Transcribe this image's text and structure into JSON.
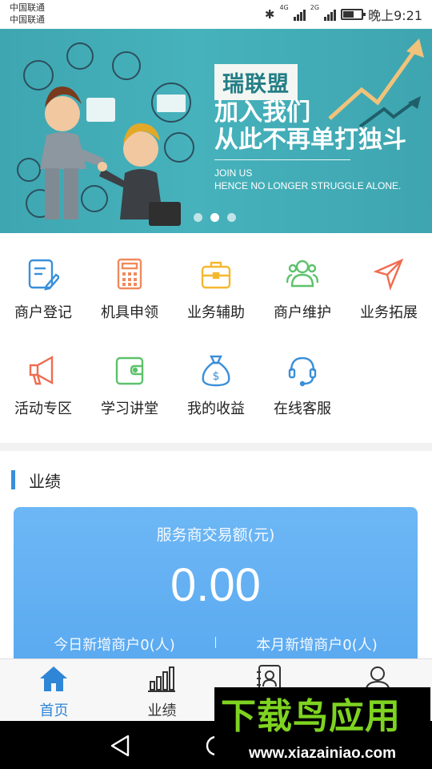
{
  "status_bar": {
    "carrier_1": "中国联通",
    "carrier_2": "中国联通",
    "network_1": "4G",
    "network_2": "2G",
    "time": "晚上9:21",
    "battery_level": 0.6
  },
  "banner": {
    "brand": "瑞联盟",
    "headline_1": "加入我们",
    "headline_2": "从此不再单打独斗",
    "sub_1": "JOIN US",
    "sub_2": "HENCE NO LONGER STRUGGLE ALONE.",
    "slide_count": 3,
    "active_slide": 2
  },
  "menu": {
    "items": [
      {
        "label": "商户登记",
        "icon": "edit-document-icon",
        "color": "#3a8fd9"
      },
      {
        "label": "机具申领",
        "icon": "calculator-icon",
        "color": "#f08a5d"
      },
      {
        "label": "业务辅助",
        "icon": "briefcase-icon",
        "color": "#f5b82e"
      },
      {
        "label": "商户维护",
        "icon": "users-icon",
        "color": "#5cc26b"
      },
      {
        "label": "业务拓展",
        "icon": "send-icon",
        "color": "#f06c50"
      },
      {
        "label": "活动专区",
        "icon": "megaphone-icon",
        "color": "#f06c50"
      },
      {
        "label": "学习讲堂",
        "icon": "wallet-icon",
        "color": "#5cc26b"
      },
      {
        "label": "我的收益",
        "icon": "money-bag-icon",
        "color": "#3a8fd9"
      },
      {
        "label": "在线客服",
        "icon": "headset-icon",
        "color": "#3a8fd9"
      }
    ]
  },
  "performance": {
    "title": "业绩",
    "card_label": "服务商交易额(元)",
    "amount": "0.00",
    "today_new": "今日新增商户0(人)",
    "month_new": "本月新增商户0(人)"
  },
  "tabs": [
    {
      "label": "首页",
      "icon": "home-icon",
      "active": true
    },
    {
      "label": "业绩",
      "icon": "bar-chart-icon",
      "active": false
    },
    {
      "label": "",
      "icon": "contacts-icon",
      "active": false
    },
    {
      "label": "",
      "icon": "profile-icon",
      "active": false
    }
  ],
  "watermark": {
    "logo": "下载鸟应用",
    "url": "www.xiazainiao.com"
  },
  "colors": {
    "accent": "#3a8fd9",
    "banner_bg": "#42acb6",
    "card_bg": "#5aa9f0",
    "active_tab": "#2f86d6"
  }
}
